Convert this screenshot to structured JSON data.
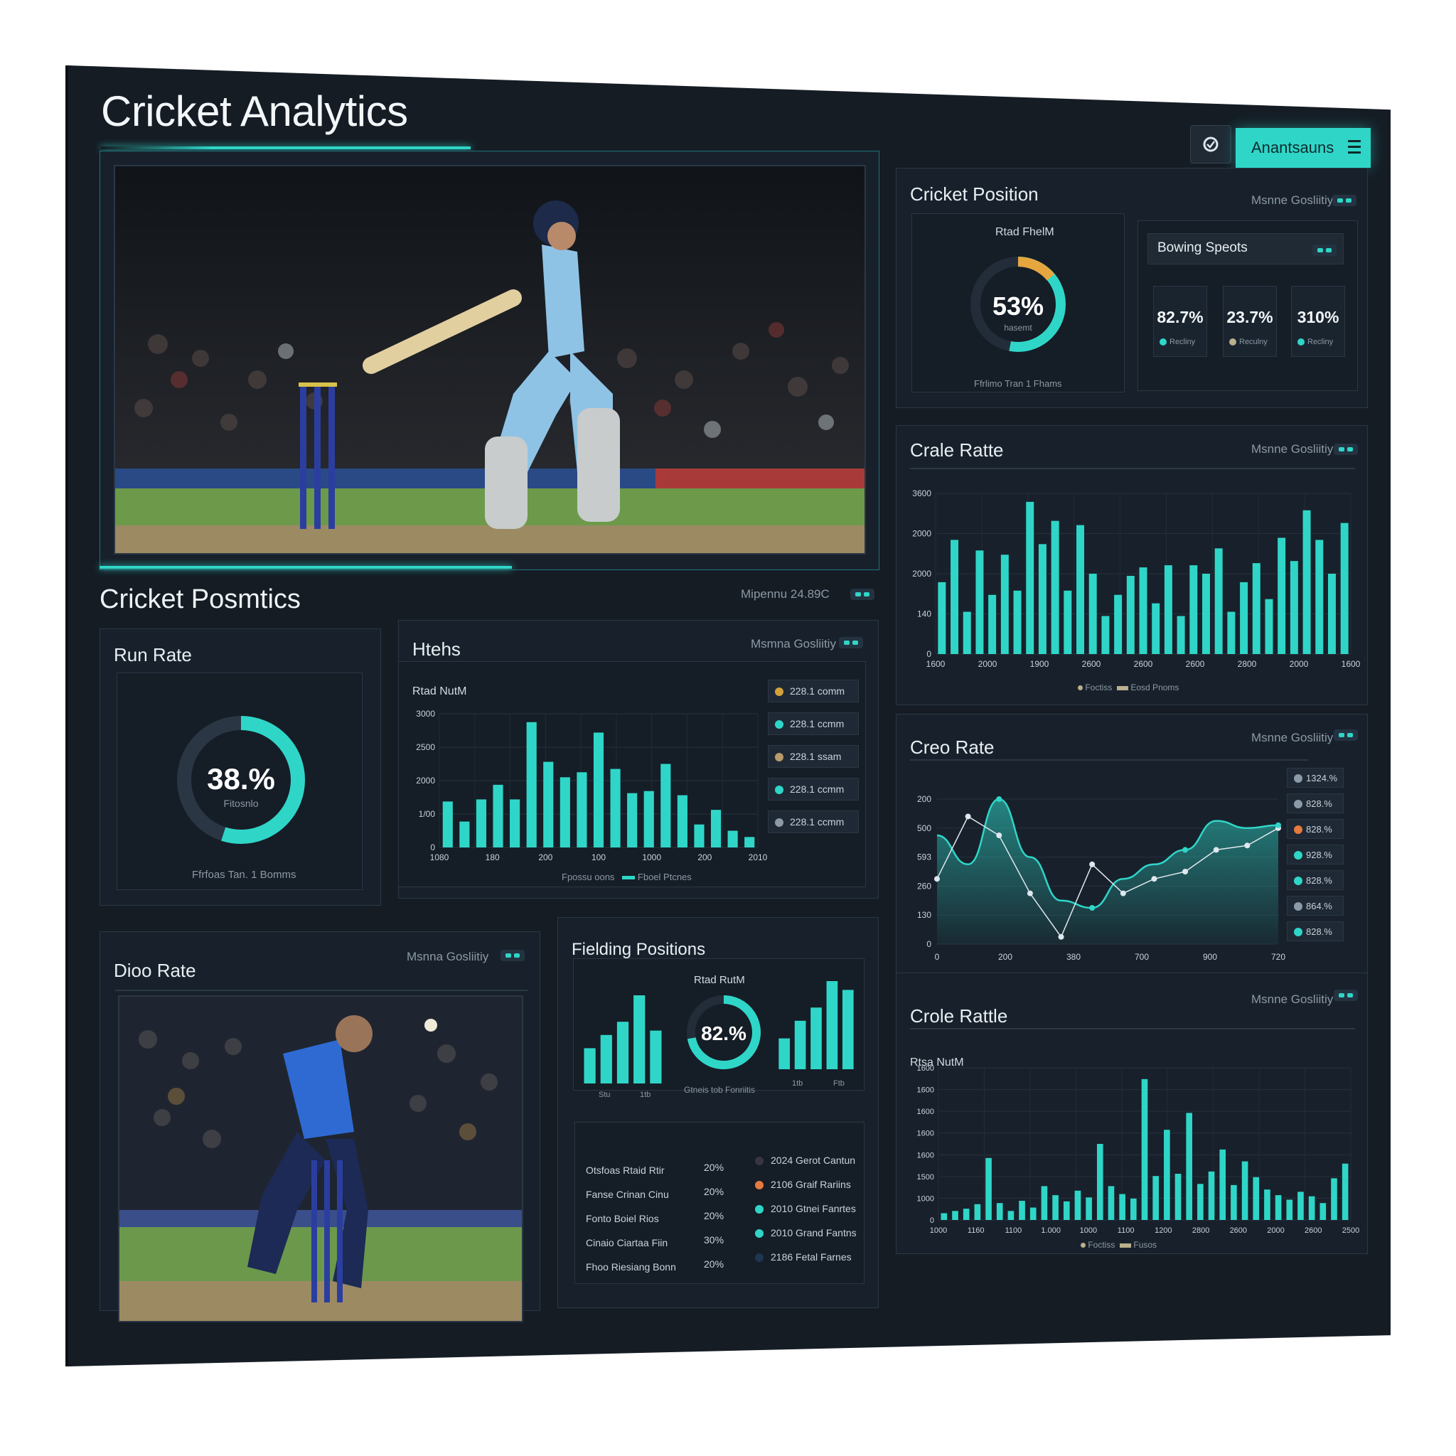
{
  "app": {
    "title": "Cricket Analytics"
  },
  "toolbar": {
    "primary_label": "Anantsauns"
  },
  "colors": {
    "accent": "#2fd6c8",
    "panel": "#18212b",
    "background": "#151c24",
    "orange": "#e6a63e"
  },
  "hero": {
    "image": "batsman-playing-shot"
  },
  "section": {
    "title": "Cricket Posmtics",
    "meta": "Mipennu 24.89C"
  },
  "run_rate": {
    "title": "Run Rate",
    "value_label": "38.%",
    "value": 0.55,
    "sub": "Fitosnlo",
    "caption": "Ffrfoas Tan. 1 Bomms"
  },
  "htehs": {
    "title": "Htehs",
    "meta": "Msmna Gosliitiy",
    "chart_label": "Rtad NutM",
    "legend": [
      "228.1 comm",
      "228.1 ccmm",
      "228.1 ssam",
      "228.1 ccmm",
      "228.1 ccmm"
    ],
    "legend_colors": [
      "#d4a03c",
      "#2fd6c8",
      "#b99b6b",
      "#2fd6c8",
      "#8c99a6"
    ],
    "footer": [
      "Fpossu oons",
      "Fboel Ptcnes"
    ]
  },
  "cricket_position": {
    "title": "Cricket Position",
    "meta": "Msnne Gosliitiy",
    "donut_title": "Rtad FhelM",
    "donut_label": "53%",
    "donut_sub": "hasemt",
    "donut_value": 0.53,
    "caption": "Ffrlimo Tran 1 Fhams",
    "bowling_title": "Bowing Speots",
    "stats": [
      {
        "value": "82.7%",
        "key": "Recliny",
        "dot": "#2fd6c8"
      },
      {
        "value": "23.7%",
        "key": "Reculny",
        "dot": "#b9b08c"
      },
      {
        "value": "310%",
        "key": "Recliny",
        "dot": "#2fd6c8"
      }
    ]
  },
  "crale_ratte": {
    "title": "Crale Ratte",
    "meta": "Msnne Gosliitiy",
    "footer": [
      "Foctiss",
      "Eosd Pnoms"
    ]
  },
  "creo_rate": {
    "title": "Creo Rate",
    "meta": "Msnne Gosliitiy",
    "legend": [
      "1324.%",
      "828.%",
      "828.%",
      "928.%",
      "828.%",
      "864.%",
      "828.%"
    ],
    "legend_colors": [
      "#8c99a6",
      "#8c99a6",
      "#e6793e",
      "#2fd6c8",
      "#2fd6c8",
      "#8c99a6",
      "#2fd6c8"
    ]
  },
  "dioo_rate": {
    "title": "Dioo Rate",
    "meta": "Msnna Gosliitiy",
    "image": "bowler-delivery"
  },
  "fielding": {
    "title": "Fielding Positions",
    "chart_label": "Rtad RutM",
    "donut_label": "82.%",
    "donut_value": 0.72,
    "donut_caption": "Gtneis tob Fonriitis",
    "left_ticks": [
      "Stu",
      "1tb"
    ],
    "right_ticks": [
      "1tb",
      "Ftb"
    ],
    "rows": [
      {
        "label": "Otsfoas Rtaid Rtir",
        "pct": "20%",
        "status": "2024 Gerot Cantun",
        "dot": "#3a3440"
      },
      {
        "label": "Fanse Crinan Cinu",
        "pct": "20%",
        "status": "2106 Graif Rariins",
        "dot": "#e6793e"
      },
      {
        "label": "Fonto Boiel Rios",
        "pct": "20%",
        "status": "2010 Gtnei Fanrtes",
        "dot": "#2fd6c8"
      },
      {
        "label": "Cinaio Ciartaa Fiin",
        "pct": "30%",
        "status": "2010 Grand Fantns",
        "dot": "#2fd6c8"
      },
      {
        "label": "Fhoo Riesiang Bonn",
        "pct": "20%",
        "status": "2186 Fetal Farnes",
        "dot": "#1f3550"
      }
    ]
  },
  "crole_rattle": {
    "title": "Crole Rattle",
    "meta": "Msnne Gosliitiy",
    "chart_label": "Rtsa NutM",
    "footer": [
      "Foctiss",
      "Fusos"
    ]
  },
  "chart_data": [
    {
      "id": "htehs",
      "type": "bar",
      "y_ticks": [
        "0",
        "1/00",
        "2000",
        "2500",
        "3000"
      ],
      "x_ticks": [
        "1080",
        "180",
        "200",
        "100",
        "1000",
        "200",
        "2010"
      ],
      "values": [
        1100,
        620,
        1150,
        1500,
        1150,
        3000,
        2050,
        1680,
        1800,
        2750,
        1880,
        1300,
        1350,
        2000,
        1250,
        550,
        900,
        400,
        250
      ],
      "ylim": [
        0,
        3200
      ]
    },
    {
      "id": "crale_ratte",
      "type": "bar",
      "y_ticks": [
        "0",
        "140",
        "2000",
        "2000",
        "3600"
      ],
      "x_ticks": [
        "1600",
        "2000",
        "1900",
        "2600",
        "2600",
        "2600",
        "2800",
        "2000",
        "1600"
      ],
      "values": [
        1700,
        2700,
        1000,
        2450,
        1400,
        2350,
        1500,
        3600,
        2600,
        3150,
        1500,
        3050,
        1900,
        900,
        1400,
        1850,
        2050,
        1200,
        2100,
        900,
        2100,
        1900,
        2500,
        1000,
        1700,
        2150,
        1300,
        2750,
        2200,
        3400,
        2700,
        1900,
        3100
      ],
      "ylim": [
        0,
        3800
      ]
    },
    {
      "id": "creo_rate",
      "type": "area",
      "y_ticks": [
        "0",
        "130",
        "260",
        "593",
        "500",
        "200"
      ],
      "x_ticks": [
        "0",
        "200",
        "380",
        "700",
        "900",
        "720"
      ],
      "series": [
        {
          "values": [
            0.45,
            0.88,
            0.75,
            0.35,
            0.05,
            0.55,
            0.35,
            0.45,
            0.5,
            0.65,
            0.68,
            0.8
          ]
        },
        {
          "values": [
            0.75,
            0.55,
            1.0,
            0.6,
            0.3,
            0.25,
            0.45,
            0.55,
            0.65,
            0.85,
            0.8,
            0.82
          ]
        }
      ]
    },
    {
      "id": "crole_rattle",
      "type": "bar",
      "y_ticks": [
        "0",
        "1000",
        "1500",
        "1600",
        "1600",
        "1600",
        "1600",
        "1600"
      ],
      "x_ticks": [
        "1000",
        "1160",
        "1100",
        "1.000",
        "1000",
        "1100",
        "1200",
        "2800",
        "2600",
        "2000",
        "2600",
        "2500"
      ],
      "values": [
        120,
        160,
        200,
        280,
        1100,
        300,
        160,
        340,
        220,
        600,
        440,
        330,
        520,
        400,
        1350,
        600,
        460,
        380,
        2500,
        780,
        1600,
        820,
        1900,
        640,
        860,
        1250,
        620,
        1040,
        760,
        540,
        440,
        360,
        500,
        420,
        300,
        740,
        1000
      ],
      "ylim": [
        0,
        2700
      ]
    },
    {
      "id": "field_left",
      "type": "bar",
      "values": [
        0.4,
        0.55,
        0.7,
        1.0,
        0.6
      ]
    },
    {
      "id": "field_right",
      "type": "bar",
      "values": [
        0.35,
        0.55,
        0.7,
        1.0,
        0.9
      ]
    }
  ]
}
